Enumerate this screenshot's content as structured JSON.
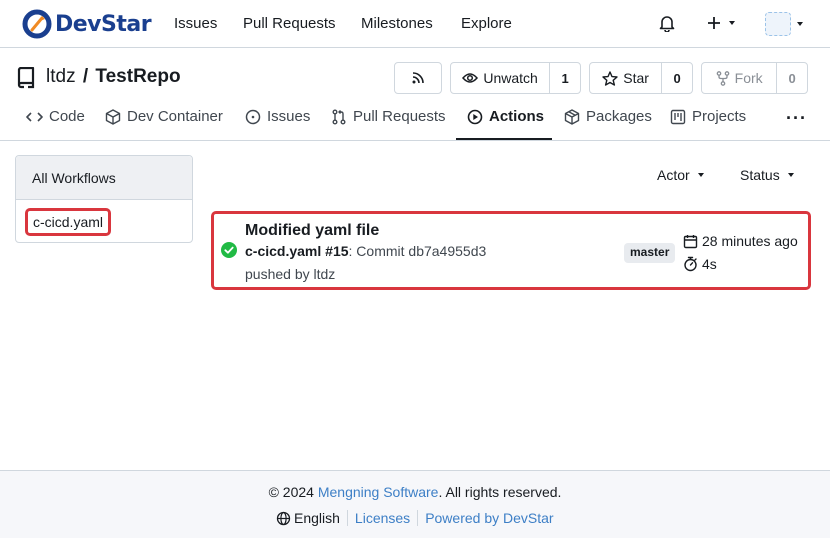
{
  "brand": {
    "name": "DevStar"
  },
  "nav": {
    "items": [
      {
        "label": "Issues"
      },
      {
        "label": "Pull Requests"
      },
      {
        "label": "Milestones"
      },
      {
        "label": "Explore"
      }
    ],
    "icons": [
      "bell-icon",
      "plus-icon",
      "avatar"
    ]
  },
  "repo": {
    "owner": "ltdz",
    "separator": "/",
    "name": "TestRepo",
    "watch": {
      "label": "Unwatch",
      "count": "1"
    },
    "star": {
      "label": "Star",
      "count": "0"
    },
    "fork": {
      "label": "Fork",
      "count": "0"
    }
  },
  "tabs": [
    {
      "label": "Code",
      "icon": "code-icon"
    },
    {
      "label": "Dev Container",
      "icon": "package-box-icon"
    },
    {
      "label": "Issues",
      "icon": "issue-circle-icon"
    },
    {
      "label": "Pull Requests",
      "icon": "pull-request-icon"
    },
    {
      "label": "Actions",
      "icon": "play-circle-icon",
      "active": true
    },
    {
      "label": "Packages",
      "icon": "package-icon"
    },
    {
      "label": "Projects",
      "icon": "project-board-icon"
    }
  ],
  "more_label": "···",
  "sidebar": {
    "header": "All Workflows",
    "items": [
      {
        "label": "c-cicd.yaml",
        "highlighted": true
      }
    ]
  },
  "filters": {
    "actor": "Actor",
    "status": "Status"
  },
  "runs": [
    {
      "title": "Modified yaml file",
      "workflow_ref": "c-cicd.yaml #15",
      "commit_text": ": Commit db7a4955d3",
      "pushed_by": "pushed by ltdz",
      "branch": "master",
      "time_ago": "28 minutes ago",
      "duration": "4s",
      "status": "success",
      "highlighted": true
    }
  ],
  "footer": {
    "copyright_prefix": "© 2024 ",
    "company": "Mengning Software",
    "copyright_suffix": ". All rights reserved.",
    "language": "English",
    "licenses": "Licenses",
    "powered": "Powered by DevStar"
  },
  "colors": {
    "brand": "#1a3f8f",
    "link": "#3d7fc6",
    "success": "#21ba45",
    "highlight": "#d9363e"
  }
}
